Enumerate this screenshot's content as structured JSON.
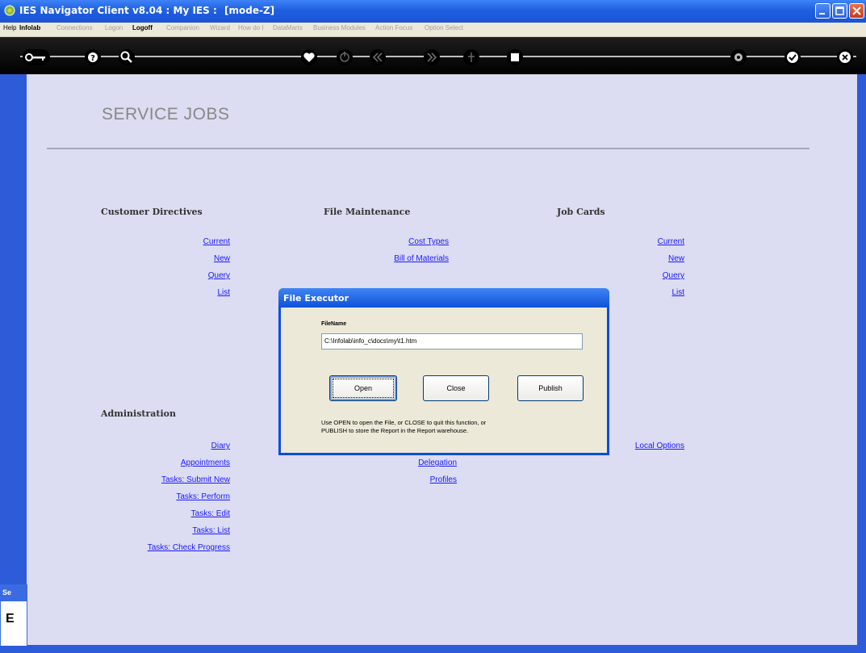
{
  "window": {
    "title": "IES Navigator Client v8.04 : My IES :",
    "mode": "[mode-Z]"
  },
  "menubar": {
    "items": [
      "Help",
      "Infolab",
      "Connections",
      "Logon",
      "Logoff",
      "Companion",
      "Wizard",
      "How do I",
      "DataMarts",
      "Business Modules",
      "Action Focus",
      "Option Select"
    ]
  },
  "page": {
    "title": "SERVICE JOBS"
  },
  "sections": {
    "customer_directives": {
      "heading": "Customer Directives",
      "links": [
        "Current",
        "New",
        "Query",
        "List"
      ]
    },
    "file_maintenance": {
      "heading": "File Maintenance",
      "links": [
        "Cost Types",
        "Bill of Materials"
      ]
    },
    "job_cards": {
      "heading": "Job Cards",
      "links": [
        "Current",
        "New",
        "Query",
        "List"
      ]
    },
    "administration": {
      "heading": "Administration",
      "links": [
        "Diary",
        "Appointments",
        "Tasks: Submit New",
        "Tasks: Perform",
        "Tasks: Edit",
        "Tasks: List",
        "Tasks: Check Progress"
      ]
    },
    "middle_admin": {
      "links": [
        "Delegation",
        "Profiles"
      ]
    },
    "right_admin": {
      "links": [
        "Local Options"
      ]
    }
  },
  "dialog": {
    "title": "File Executor",
    "field_label": "FileName",
    "field_value": "C:\\Infolab\\info_c\\docs\\my\\t1.htm",
    "open_label": "Open",
    "close_label": "Close",
    "publish_label": "Publish",
    "help_line1": "Use OPEN to open the File, or CLOSE to quit this function, or",
    "help_line2": "PUBLISH to store the Report in the Report warehouse."
  },
  "side_panel": {
    "caption": "Se",
    "char": "E"
  }
}
